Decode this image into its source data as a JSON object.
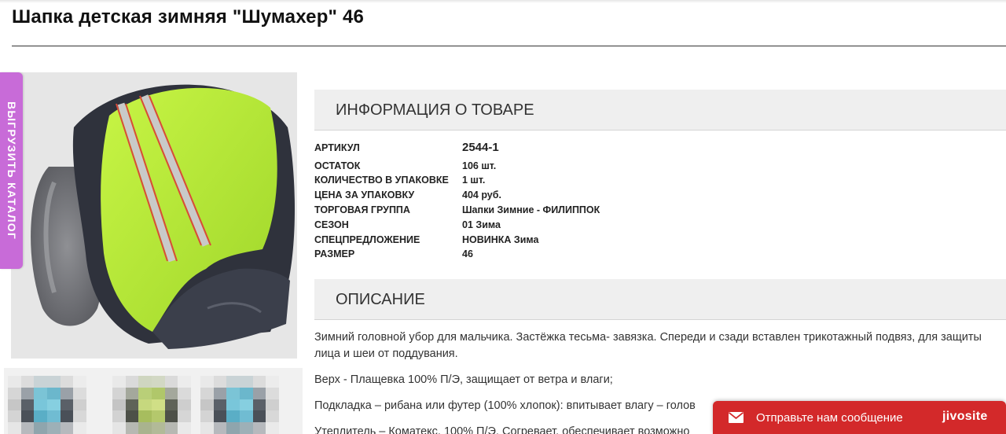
{
  "product": {
    "title": "Шапка детская зимняя \"Шумахер\" 46"
  },
  "side_tab": {
    "label": "ВЫГРУЗИТЬ КАТАЛОГ",
    "color": "#c86bd8"
  },
  "info_section": {
    "heading": "ИНФОРМАЦИЯ О ТОВАРЕ",
    "rows": [
      {
        "label": "АРТИКУЛ",
        "value": "2544-1"
      },
      {
        "label": "ОСТАТОК",
        "value": "106 шт."
      },
      {
        "label": "КОЛИЧЕСТВО В УПАКОВКЕ",
        "value": "1 шт."
      },
      {
        "label": "ЦЕНА ЗА УПАКОВКУ",
        "value": "404 руб."
      },
      {
        "label": "ТОРГОВАЯ ГРУППА",
        "value": "Шапки Зимние - ФИЛИППОК"
      },
      {
        "label": "СЕЗОН",
        "value": "01 Зима"
      },
      {
        "label": "СПЕЦПРЕДЛОЖЕНИЕ",
        "value": "НОВИНКА Зима"
      },
      {
        "label": "РАЗМЕР",
        "value": "46"
      }
    ]
  },
  "description_section": {
    "heading": "ОПИСАНИЕ",
    "paragraphs": [
      "Зимний головной убор для мальчика. Застёжка тесьма- завязка. Спереди и сзади вставлен трикотажный подвяз, для защиты лица и шеи от поддувания.",
      "Верх - Плащевка 100% П/Э, защищает от ветра и влаги;",
      "Подкладка – рибана или футер (100% хлопок): впитывает влагу – голов",
      "Утеплитель – Коматекс, 100% П/Э. Согревает, обеспечивает возможно"
    ]
  },
  "chat_widget": {
    "label": "Отправьте нам сообщение",
    "brand": "jivosite",
    "color": "#d3292a"
  },
  "thumbnails": [
    {
      "name": "thumb-1"
    },
    {
      "name": "thumb-2"
    },
    {
      "name": "thumb-3"
    }
  ]
}
